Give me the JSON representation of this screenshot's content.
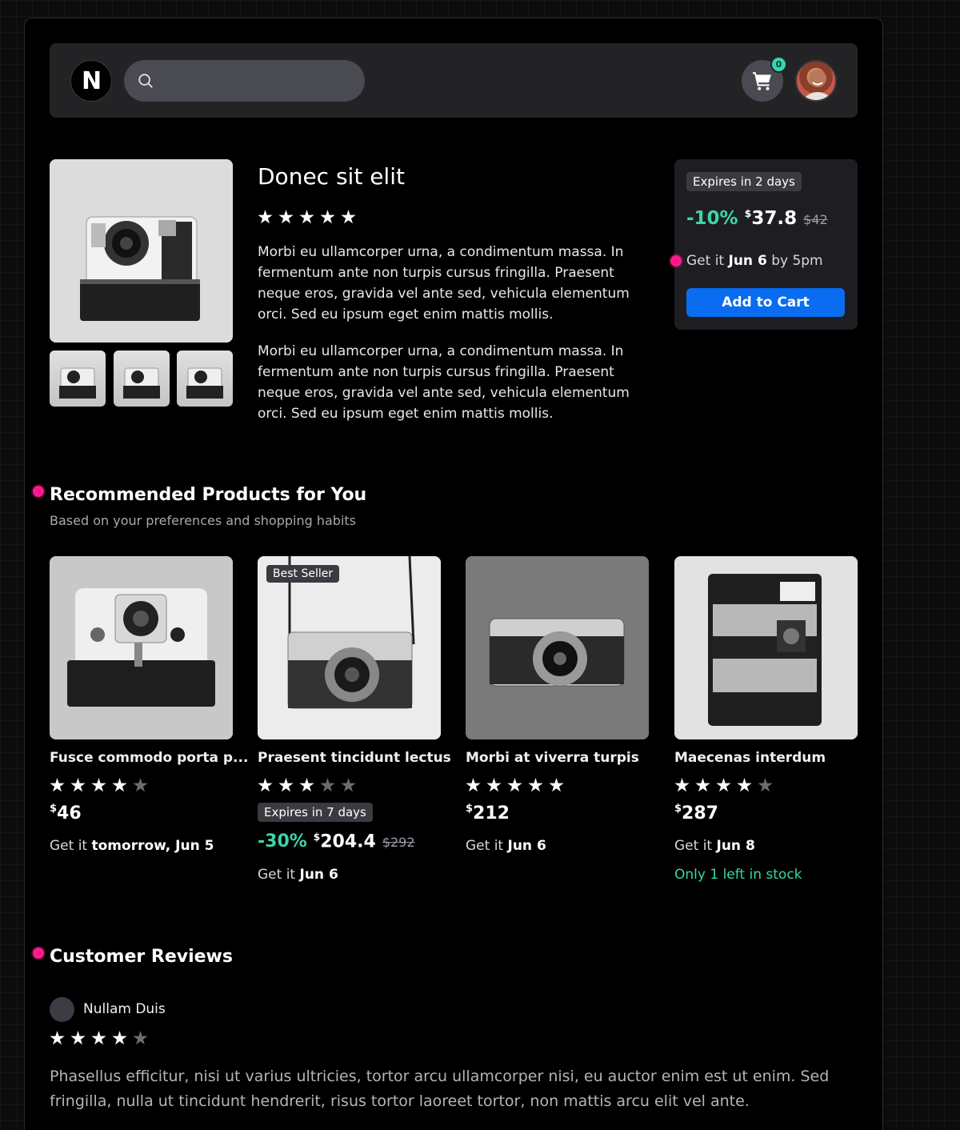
{
  "header": {
    "logo_letter": "N",
    "search_placeholder": "",
    "cart_count": "0"
  },
  "product": {
    "title": "Donec sit elit",
    "rating": 5,
    "description": [
      "Morbi eu ullamcorper urna, a condimentum massa. In fermentum ante non turpis cursus fringilla. Praesent neque eros, gravida vel ante sed, vehicula elementum orci. Sed eu ipsum eget enim mattis mollis.",
      "Morbi eu ullamcorper urna, a condimentum massa. In fermentum ante non turpis cursus fringilla. Praesent neque eros, gravida vel ante sed, vehicula elementum orci. Sed eu ipsum eget enim mattis mollis."
    ]
  },
  "buybox": {
    "expires": "Expires in 2 days",
    "discount": "-10%",
    "currency": "$",
    "price": "37.8",
    "old_price": "$42",
    "delivery_prefix": "Get it",
    "delivery_date": "Jun 6",
    "delivery_suffix": "by 5pm",
    "add_to_cart": "Add to Cart"
  },
  "recommended": {
    "title": "Recommended Products for You",
    "subtitle": "Based on your preferences and shopping habits",
    "items": [
      {
        "name": "Fusce commodo porta p...",
        "rating": 4,
        "currency": "$",
        "price": "46",
        "delivery_prefix": "Get it",
        "delivery_date": "tomorrow, Jun 5"
      },
      {
        "name": "Praesent tincidunt lectus",
        "rating": 3,
        "badge": "Best Seller",
        "expires": "Expires in 7 days",
        "discount": "-30%",
        "currency": "$",
        "price": "204.4",
        "old_price": "$292",
        "delivery_prefix": "Get it",
        "delivery_date": "Jun 6"
      },
      {
        "name": "Morbi at viverra turpis",
        "rating": 5,
        "currency": "$",
        "price": "212",
        "delivery_prefix": "Get it",
        "delivery_date": "Jun 6"
      },
      {
        "name": "Maecenas interdum",
        "rating": 4,
        "currency": "$",
        "price": "287",
        "delivery_prefix": "Get it",
        "delivery_date": "Jun 8",
        "stock": "Only 1 left in stock"
      }
    ]
  },
  "reviews": {
    "title": "Customer Reviews",
    "items": [
      {
        "author": "Nullam Duis",
        "rating": 4,
        "text": "Phasellus efficitur, nisi ut varius ultricies, tortor arcu ullamcorper nisi, eu auctor enim est ut enim. Sed fringilla, nulla ut tincidunt hendrerit, risus tortor laoreet tortor, non mattis arcu elit vel ante."
      }
    ]
  },
  "colors": {
    "accent_green": "#3ad6a8",
    "button_blue": "#0a6cf0",
    "marker_pink": "#ff1a8c"
  }
}
